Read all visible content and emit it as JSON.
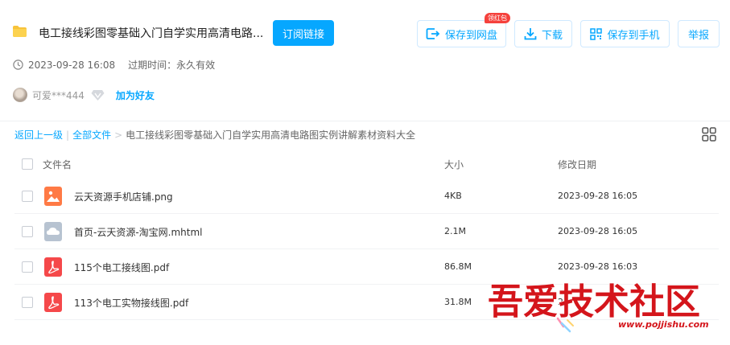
{
  "header": {
    "title": "电工接线彩图零基础入门自学实用高清电路...",
    "subscribe_label": "订阅链接",
    "actions": {
      "save_to_netdisk": "保存到网盘",
      "download": "下载",
      "save_to_phone": "保存到手机",
      "report": "举报"
    },
    "badge": "领红包"
  },
  "meta": {
    "created": "2023-09-28 16:08",
    "expire_label": "过期时间：永久有效"
  },
  "user": {
    "name": "可爱***444",
    "add_friend": "加为好友"
  },
  "breadcrumb": {
    "back": "返回上一级",
    "sep": "|",
    "all_files": "全部文件",
    "arrow": ">",
    "current": "电工接线彩图零基础入门自学实用高清电路图实例讲解素材资料大全"
  },
  "columns": {
    "name": "文件名",
    "size": "大小",
    "date": "修改日期"
  },
  "files": [
    {
      "name": "云天资源手机店铺.png",
      "size": "4KB",
      "date": "2023-09-28 16:05",
      "icon": "image-file-icon",
      "color": "#ff7a45"
    },
    {
      "name": "首页-云天资源-淘宝网.mhtml",
      "size": "2.1M",
      "date": "2023-09-28 16:05",
      "icon": "web-file-icon",
      "color": "#b7c3d1"
    },
    {
      "name": "115个电工接线图.pdf",
      "size": "86.8M",
      "date": "2023-09-28 16:03",
      "icon": "pdf-file-icon",
      "color": "#f5484a"
    },
    {
      "name": "113个电工实物接线图.pdf",
      "size": "31.8M",
      "date": "20",
      "icon": "pdf-file-icon",
      "color": "#f5484a"
    }
  ],
  "watermark": {
    "text": "吾爱技术社区",
    "url": "www.pojjishu.com"
  },
  "colors": {
    "accent": "#06a7ff",
    "badge": "#f5413c",
    "watermark": "#d4151b"
  }
}
